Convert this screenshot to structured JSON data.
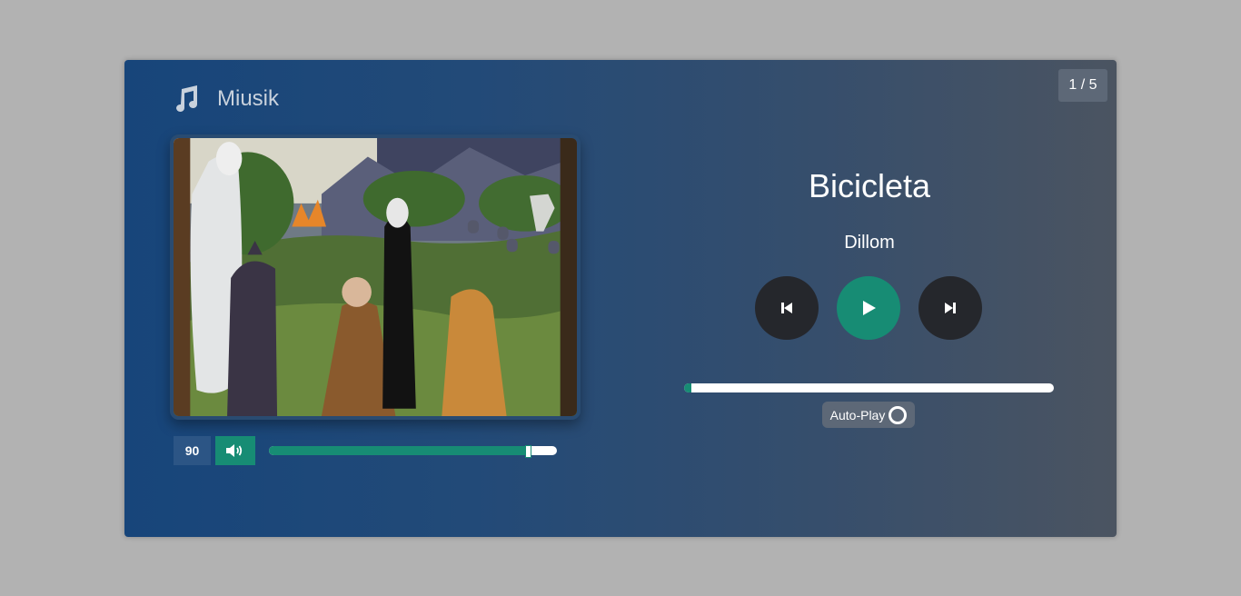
{
  "app": {
    "title": "Miusik",
    "icon": "music-note-icon"
  },
  "counter": "1 / 5",
  "track": {
    "title": "Bicicleta",
    "artist": "Dillom",
    "progress": 0.02
  },
  "volume": {
    "value": "90",
    "level": 0.9,
    "icon": "speaker-icon"
  },
  "controls": {
    "prev_icon": "skip-back-icon",
    "play_icon": "play-icon",
    "next_icon": "skip-forward-icon"
  },
  "autoplay": {
    "label": "Auto-Play",
    "icon": "loading-ring-icon"
  },
  "colors": {
    "accent": "#178c74",
    "dark_button": "#25272c",
    "badge": "#5d6877"
  }
}
